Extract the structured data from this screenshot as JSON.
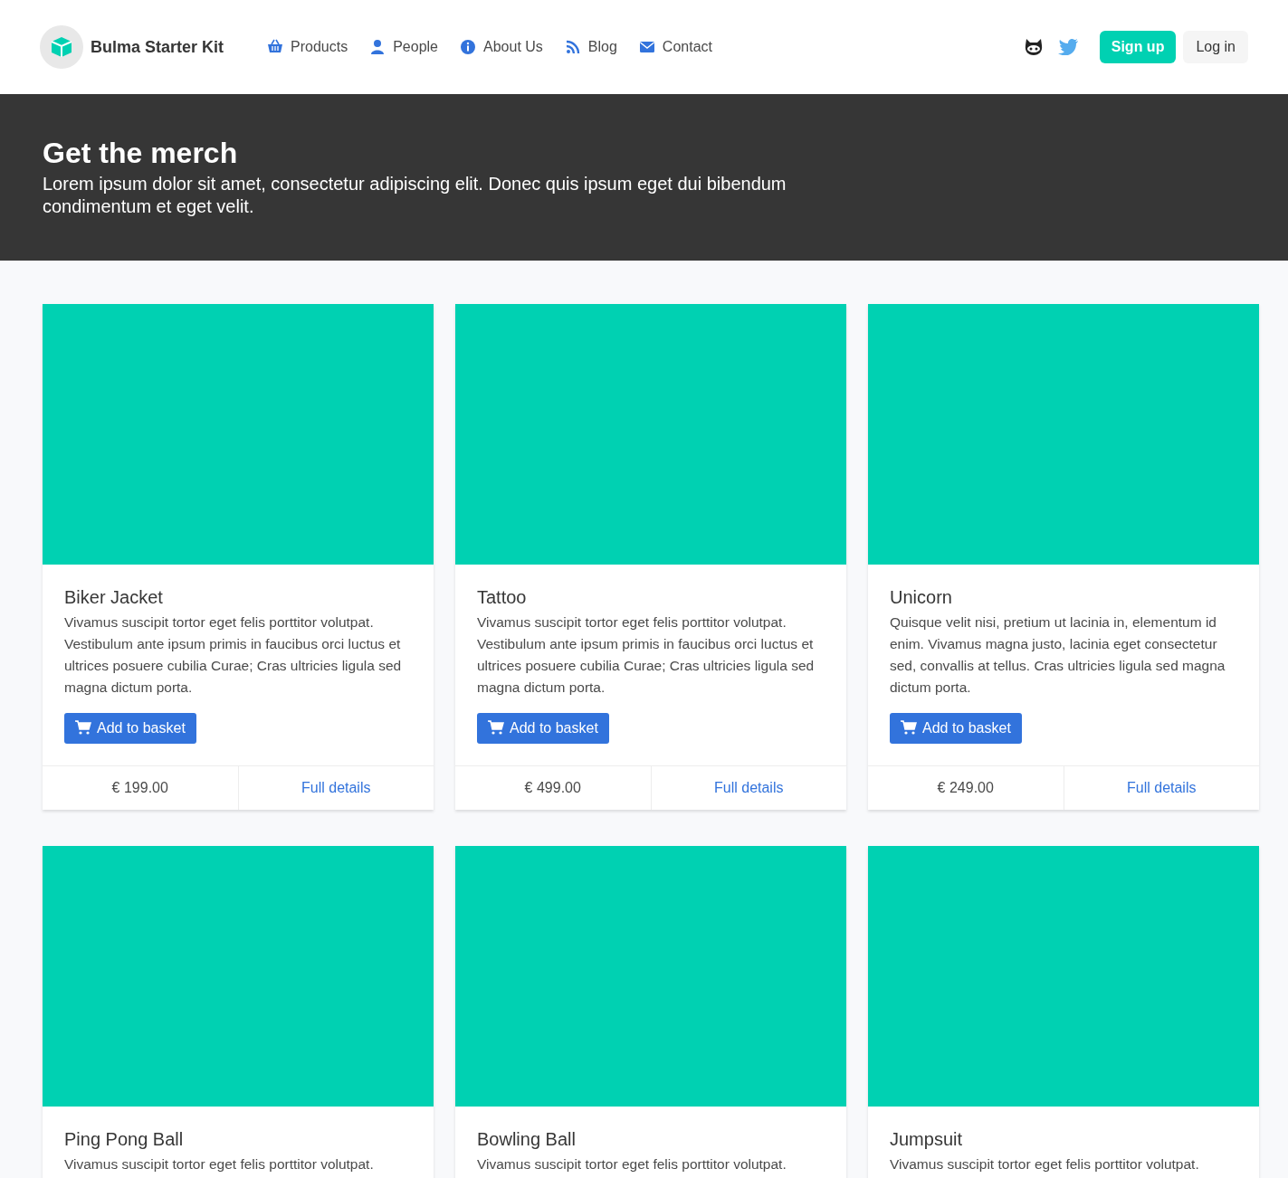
{
  "brand": {
    "title": "Bulma Starter Kit"
  },
  "nav": [
    {
      "label": "Products"
    },
    {
      "label": "People"
    },
    {
      "label": "About Us"
    },
    {
      "label": "Blog"
    },
    {
      "label": "Contact"
    }
  ],
  "actions": {
    "signup": "Sign up",
    "login": "Log in"
  },
  "hero": {
    "title": "Get the merch",
    "subtitle": "Lorem ipsum dolor sit amet, consectetur adipiscing elit. Donec quis ipsum eget dui bibendum condimentum et eget velit."
  },
  "products": [
    {
      "name": "Biker Jacket",
      "description": "Vivamus suscipit tortor eget felis porttitor volutpat. Vestibulum ante ipsum primis in faucibus orci luctus et ultrices posuere cubilia Curae; Cras ultricies ligula sed magna dictum porta.",
      "button": "Add to basket",
      "price": "€ 199.00",
      "link": "Full details"
    },
    {
      "name": "Tattoo",
      "description": "Vivamus suscipit tortor eget felis porttitor volutpat. Vestibulum ante ipsum primis in faucibus orci luctus et ultrices posuere cubilia Curae; Cras ultricies ligula sed magna dictum porta.",
      "button": "Add to basket",
      "price": "€ 499.00",
      "link": "Full details"
    },
    {
      "name": "Unicorn",
      "description": "Quisque velit nisi, pretium ut lacinia in, elementum id enim. Vivamus magna justo, lacinia eget consectetur sed, convallis at tellus. Cras ultricies ligula sed magna dictum porta.",
      "button": "Add to basket",
      "price": "€ 249.00",
      "link": "Full details"
    },
    {
      "name": "Ping Pong Ball",
      "description": "Vivamus suscipit tortor eget felis porttitor volutpat."
    },
    {
      "name": "Bowling Ball",
      "description": "Vivamus suscipit tortor eget felis porttitor volutpat."
    },
    {
      "name": "Jumpsuit",
      "description": "Vivamus suscipit tortor eget felis porttitor volutpat."
    }
  ]
}
